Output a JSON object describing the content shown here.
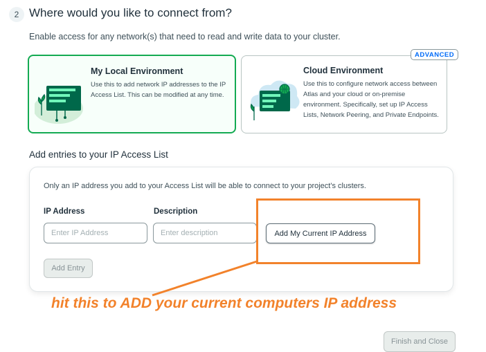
{
  "step": {
    "number": "2",
    "title": "Where would you like to connect from?",
    "description": "Enable access for any network(s) that need to read and write data to your cluster."
  },
  "options": {
    "local": {
      "title": "My Local Environment",
      "text": "Use this to add network IP addresses to the IP Access List. This can be modified at any time."
    },
    "cloud": {
      "badge": "ADVANCED",
      "title": "Cloud Environment",
      "text": "Use this to configure network access between Atlas and your cloud or on-premise environment. Specifically, set up IP Access Lists, Network Peering, and Private Endpoints."
    }
  },
  "access_list": {
    "title": "Add entries to your IP Access List",
    "info": "Only an IP address you add to your Access List will be able to connect to your project's clusters.",
    "ip_label": "IP Address",
    "ip_placeholder": "Enter IP Address",
    "description_label": "Description",
    "description_placeholder": "Enter description",
    "add_current_button": "Add My Current IP Address",
    "add_entry_button": "Add Entry"
  },
  "annotation": {
    "text": "hit this to ADD your current computers IP address",
    "color": "#f2822b"
  },
  "footer": {
    "finish_button": "Finish and Close"
  },
  "colors": {
    "selected_border": "#13aa52",
    "accent_blue": "#016bf8"
  }
}
